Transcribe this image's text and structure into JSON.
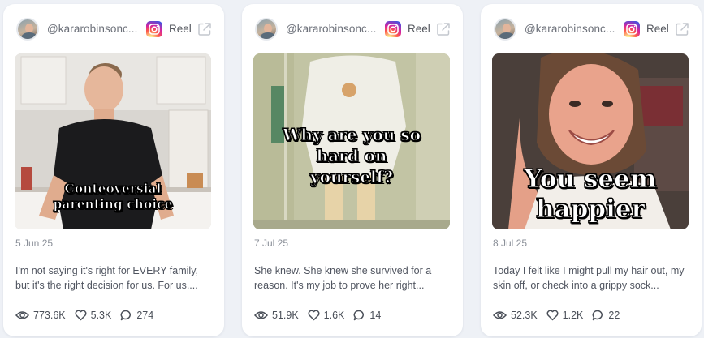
{
  "colors": {
    "background": "#eef1f6",
    "card": "#ffffff",
    "muted_text": "#8a8f98",
    "body_text": "#505560"
  },
  "cards": [
    {
      "handle": "@kararobinsonc...",
      "platform_icon": "instagram-icon",
      "type_label": "Reel",
      "overlay_lines": [
        "Conteoversial",
        "parenting choice"
      ],
      "date": "5 Jun 25",
      "caption": "I'm not saying it's right for EVERY family, but it's the right decision for us. For us,...",
      "stats": {
        "views": "773.6K",
        "likes": "5.3K",
        "comments": "274"
      }
    },
    {
      "handle": "@kararobinsonc...",
      "platform_icon": "instagram-icon",
      "type_label": "Reel",
      "overlay_lines": [
        "Why are you so",
        "hard on",
        "yourself?"
      ],
      "date": "7 Jul 25",
      "caption": "She knew. She knew she survived for a reason. It's my job to prove her right...",
      "stats": {
        "views": "51.9K",
        "likes": "1.6K",
        "comments": "14"
      }
    },
    {
      "handle": "@kararobinsonc...",
      "platform_icon": "instagram-icon",
      "type_label": "Reel",
      "overlay_lines": [
        "You seem",
        "happier"
      ],
      "date": "8 Jul 25",
      "caption": "Today I felt like I might pull my hair out, my skin off, or check into a grippy sock...",
      "stats": {
        "views": "52.3K",
        "likes": "1.2K",
        "comments": "22"
      }
    }
  ]
}
